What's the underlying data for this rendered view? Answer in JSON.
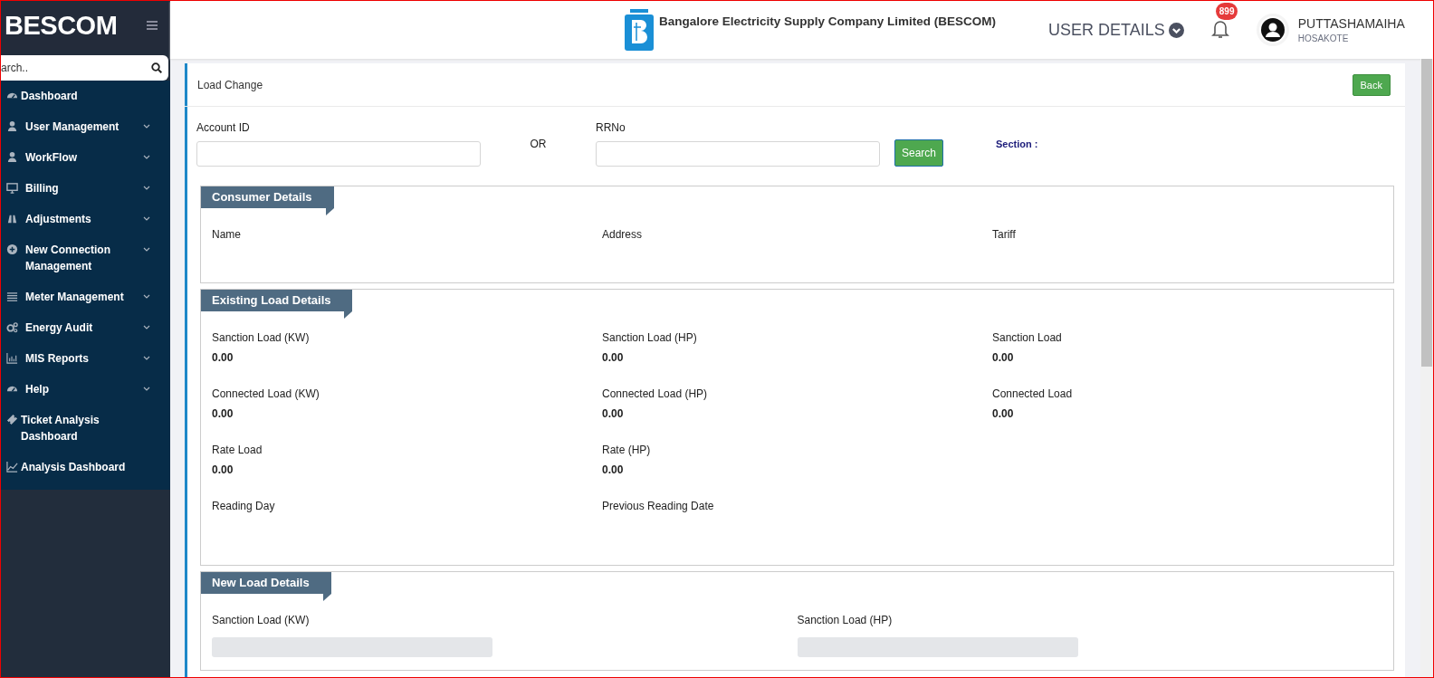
{
  "sidebar": {
    "brand": "BESCOM",
    "search": {
      "placeholder": "arch.."
    },
    "items": [
      {
        "label": "Dashboard",
        "expandable": false
      },
      {
        "label": "User Management",
        "expandable": true
      },
      {
        "label": "WorkFlow",
        "expandable": true
      },
      {
        "label": "Billing",
        "expandable": true
      },
      {
        "label": "Adjustments",
        "expandable": true
      },
      {
        "label": "New Connection Management",
        "expandable": true
      },
      {
        "label": "Meter Management",
        "expandable": true
      },
      {
        "label": "Energy Audit",
        "expandable": true
      },
      {
        "label": "MIS Reports",
        "expandable": true
      },
      {
        "label": "Help",
        "expandable": true
      },
      {
        "label": "Ticket Analysis Dashboard",
        "expandable": false
      },
      {
        "label": "Analysis Dashboard",
        "expandable": false
      }
    ]
  },
  "header": {
    "company": "Bangalore Electricity Supply Company Limited (BESCOM)",
    "user_details": "USER DETAILS",
    "notifications": "899",
    "user_name": "PUTTASHAMAIHA",
    "user_location": "HOSAKOTE"
  },
  "page": {
    "title": "Load Change",
    "back": "Back",
    "form": {
      "account_label": "Account ID",
      "or": "OR",
      "rrno_label": "RRNo",
      "search": "Search",
      "section_label": "Section :"
    },
    "sections": [
      {
        "title": "Consumer Details",
        "rows": [
          [
            {
              "label": "Name"
            },
            {
              "label": "Address"
            },
            {
              "label": "Tariff"
            }
          ]
        ]
      },
      {
        "title": "Existing Load Details",
        "rows": [
          [
            {
              "label": "Sanction Load (KW)",
              "value": "0.00"
            },
            {
              "label": "Sanction Load (HP)",
              "value": "0.00"
            },
            {
              "label": "Sanction Load",
              "value": "0.00"
            }
          ],
          [
            {
              "label": "Connected Load (KW)",
              "value": "0.00"
            },
            {
              "label": "Connected Load (HP)",
              "value": "0.00"
            },
            {
              "label": "Connected Load",
              "value": "0.00"
            }
          ],
          [
            {
              "label": "Rate Load",
              "value": "0.00"
            },
            {
              "label": "Rate (HP)",
              "value": "0.00"
            }
          ],
          [
            {
              "label": "Reading Day"
            },
            {
              "label": "Previous Reading Date"
            }
          ]
        ]
      },
      {
        "title": "New Load Details",
        "rows": [
          [
            {
              "label": "Sanction Load (KW)",
              "kind": "input"
            },
            {
              "label": "Sanction Load (HP)",
              "kind": "input"
            }
          ]
        ]
      }
    ]
  }
}
